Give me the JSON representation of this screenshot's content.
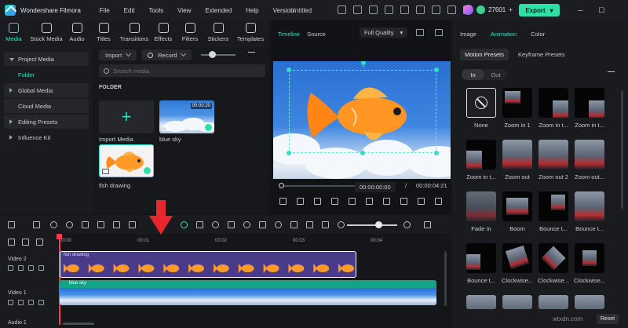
{
  "titlebar": {
    "app_name": "Wondershare Filmora",
    "menu": [
      "File",
      "Edit",
      "Tools",
      "View",
      "Extended",
      "Help",
      "Version"
    ],
    "document_title": "Untitled",
    "credits": "27601",
    "export_label": "Export"
  },
  "media_tabs": [
    {
      "label": "Media",
      "icon": "media-icon",
      "active": true
    },
    {
      "label": "Stock Media",
      "icon": "stock-media-icon",
      "active": false
    },
    {
      "label": "Audio",
      "icon": "music-note-icon",
      "active": false
    },
    {
      "label": "Titles",
      "icon": "title-t-icon",
      "active": false
    },
    {
      "label": "Transitions",
      "icon": "transitions-icon",
      "active": false
    },
    {
      "label": "Effects",
      "icon": "effects-icon",
      "active": false
    },
    {
      "label": "Filters",
      "icon": "filters-icon",
      "active": false
    },
    {
      "label": "Stickers",
      "icon": "stickers-icon",
      "active": false
    },
    {
      "label": "Templates",
      "icon": "templates-icon",
      "active": false
    }
  ],
  "sidebar": {
    "items": [
      {
        "label": "Project Media"
      },
      {
        "label": "Folder"
      },
      {
        "label": "Global Media"
      },
      {
        "label": "Cloud Media"
      },
      {
        "label": "Editing Presets"
      },
      {
        "label": "Influence Kit"
      }
    ]
  },
  "media_panel": {
    "import_label": "Import",
    "record_label": "Record",
    "search_placeholder": "Search media",
    "folder_label": "FOLDER",
    "import_media_label": "Import Media",
    "clips": [
      {
        "name": "blue sky",
        "duration": "00:00:20"
      },
      {
        "name": "fish drawing"
      }
    ]
  },
  "preview": {
    "tab_timeline": "Timeline",
    "tab_source": "Source",
    "quality": "Full Quality",
    "current_time": "00:00:00:00",
    "separator": "/",
    "total_time": "00:00:04:21"
  },
  "right_panel": {
    "tabs": [
      "Image",
      "Animation",
      "Color"
    ],
    "active_tab": "Animation",
    "subtabs": [
      "Motion Presets",
      "Keyframe Presets"
    ],
    "toggle": [
      "In",
      "Out"
    ],
    "presets": [
      "None",
      "Zoom in 1",
      "Zoom in t...",
      "Zoom in t...",
      "Zoom in t...",
      "Zoom out",
      "Zoom out 2",
      "Zoom out...",
      "Fade In",
      "Boom",
      "Bounce t...",
      "Bounce t...",
      "Bounce t...",
      "Clockwise...",
      "Clockwise...",
      "Clockwise..."
    ],
    "reset_label": "Reset"
  },
  "timeline": {
    "ruler_ticks": [
      "00:00",
      "00:01",
      "00:02",
      "00:03",
      "00:04"
    ],
    "tracks": [
      {
        "name": "Video 2"
      },
      {
        "name": "Video 1"
      },
      {
        "name": "Audio 1"
      }
    ],
    "clip_fish_name": "fish drawing",
    "clip_sky_name": "blue sky"
  },
  "watermark": "wtxdn.com"
}
